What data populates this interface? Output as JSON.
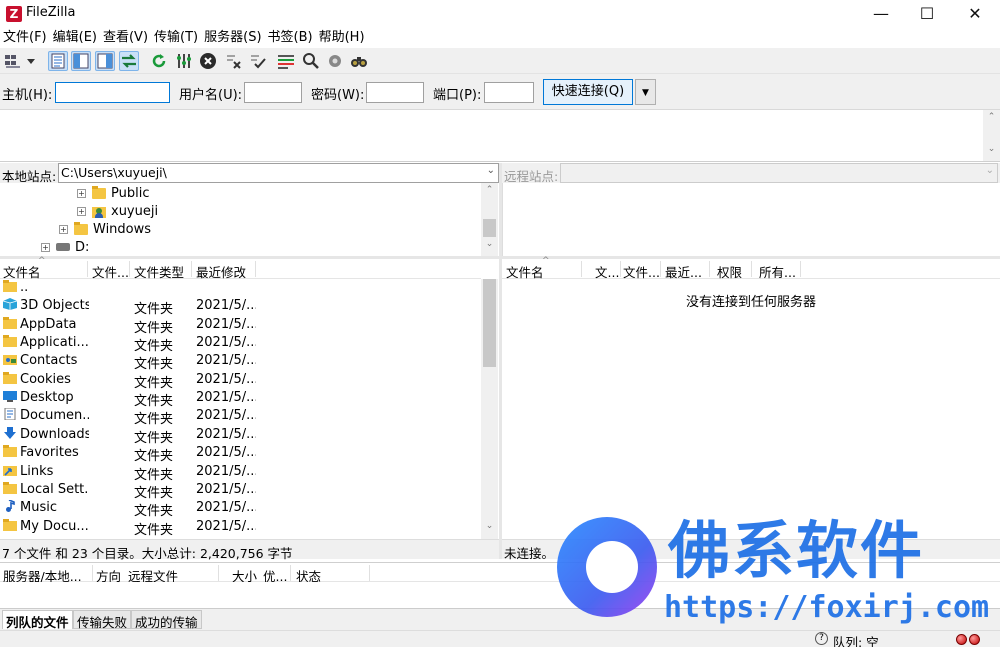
{
  "window": {
    "title": "FileZilla",
    "app_icon": "Z",
    "minimize": "—",
    "maximize": "☐",
    "close": "✕"
  },
  "menu": [
    "文件(F)",
    "编辑(E)",
    "查看(V)",
    "传输(T)",
    "服务器(S)",
    "书签(B)",
    "帮助(H)"
  ],
  "toolbar": {
    "icons": [
      "site-manager-icon",
      "dropdown-arrow-icon",
      "toggle-message-log-icon",
      "toggle-local-tree-icon",
      "toggle-remote-tree-icon",
      "toggle-queue-icon",
      "refresh-icon",
      "process-queue-icon",
      "cancel-icon",
      "disconnect-icon",
      "reconnect-icon",
      "filter-icon",
      "search-remote-icon",
      "compare-icon",
      "find-files-icon"
    ]
  },
  "quickconnect": {
    "host_label": "主机(H):",
    "user_label": "用户名(U):",
    "pass_label": "密码(W):",
    "port_label": "端口(P):",
    "host_value": "",
    "user_value": "",
    "pass_value": "",
    "port_value": "",
    "connect_button": "快速连接(Q)"
  },
  "local": {
    "site_label": "本地站点:",
    "path": "C:\\Users\\xuyueji\\",
    "tree": [
      {
        "label": "Public",
        "type": "folder"
      },
      {
        "label": "xuyueji",
        "type": "user-folder"
      },
      {
        "label": "Windows",
        "type": "folder"
      },
      {
        "label": "D:",
        "type": "drive"
      }
    ],
    "columns": [
      "文件名",
      "文件...",
      "文件类型",
      "最近修改"
    ],
    "files": [
      {
        "name": "..",
        "type": "",
        "modified": "",
        "icon": "folder"
      },
      {
        "name": "3D Objects",
        "type": "文件夹",
        "modified": "2021/5/...",
        "icon": "3d"
      },
      {
        "name": "AppData",
        "type": "文件夹",
        "modified": "2021/5/...",
        "icon": "folder"
      },
      {
        "name": "Applicati...",
        "type": "文件夹",
        "modified": "2021/5/...",
        "icon": "folder"
      },
      {
        "name": "Contacts",
        "type": "文件夹",
        "modified": "2021/5/...",
        "icon": "contacts"
      },
      {
        "name": "Cookies",
        "type": "文件夹",
        "modified": "2021/5/...",
        "icon": "folder"
      },
      {
        "name": "Desktop",
        "type": "文件夹",
        "modified": "2021/5/...",
        "icon": "desktop"
      },
      {
        "name": "Documen...",
        "type": "文件夹",
        "modified": "2021/5/...",
        "icon": "document"
      },
      {
        "name": "Downloads",
        "type": "文件夹",
        "modified": "2021/5/...",
        "icon": "download"
      },
      {
        "name": "Favorites",
        "type": "文件夹",
        "modified": "2021/5/...",
        "icon": "folder"
      },
      {
        "name": "Links",
        "type": "文件夹",
        "modified": "2021/5/...",
        "icon": "link"
      },
      {
        "name": "Local Sett...",
        "type": "文件夹",
        "modified": "2021/5/...",
        "icon": "folder"
      },
      {
        "name": "Music",
        "type": "文件夹",
        "modified": "2021/5/...",
        "icon": "music"
      },
      {
        "name": "My Docu...",
        "type": "文件夹",
        "modified": "2021/5/...",
        "icon": "folder"
      }
    ],
    "status": "7 个文件 和 23 个目录。大小总计: 2,420,756 字节"
  },
  "remote": {
    "site_label": "远程站点:",
    "path": "",
    "columns": [
      "文件名",
      "文...",
      "文件...",
      "最近...",
      "权限",
      "所有..."
    ],
    "empty_message": "没有连接到任何服务器",
    "status": "未连接。"
  },
  "queue": {
    "columns": [
      "服务器/本地...",
      "方向",
      "远程文件",
      "大小",
      "优...",
      "状态"
    ],
    "tabs": [
      "列队的文件",
      "传输失败",
      "成功的传输"
    ],
    "status": "队列: 空"
  },
  "watermark": {
    "text": "佛系软件",
    "url": "https://foxirj.com"
  },
  "colors": {
    "accent": "#0078d7",
    "watermark": "#1d6fe6",
    "folder": "#f4c542"
  }
}
